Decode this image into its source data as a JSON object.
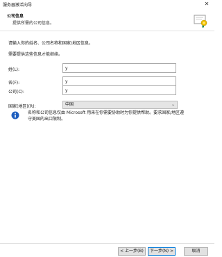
{
  "window": {
    "title": "服务器激活向导",
    "close_glyph": "✕"
  },
  "header": {
    "title": "公司信息",
    "subtitle": "提供所需的公司信息。"
  },
  "form": {
    "intro": "请输入你的姓名、公司名称和国家/地区信息。",
    "note": "需要提供这些信息才能继续。",
    "last_name_label": "姓(L):",
    "last_name_value": "y",
    "first_name_label": "名(F):",
    "first_name_value": "y",
    "company_label": "公司(C):",
    "company_value": "y",
    "country_label": "国家(地区)(R):",
    "country_value": "中国"
  },
  "info": {
    "text": "名称和公司信息仅由 Microsoft 用来在你需要协助时为你提供帮助。要求国家/地区遵守美国的出口限制。"
  },
  "buttons": {
    "back": "< 上一步(B)",
    "next": "下一步(N) >",
    "cancel": "取消"
  },
  "colors": {
    "accent": "#0078d7",
    "info_icon": "#1f5fbf"
  }
}
